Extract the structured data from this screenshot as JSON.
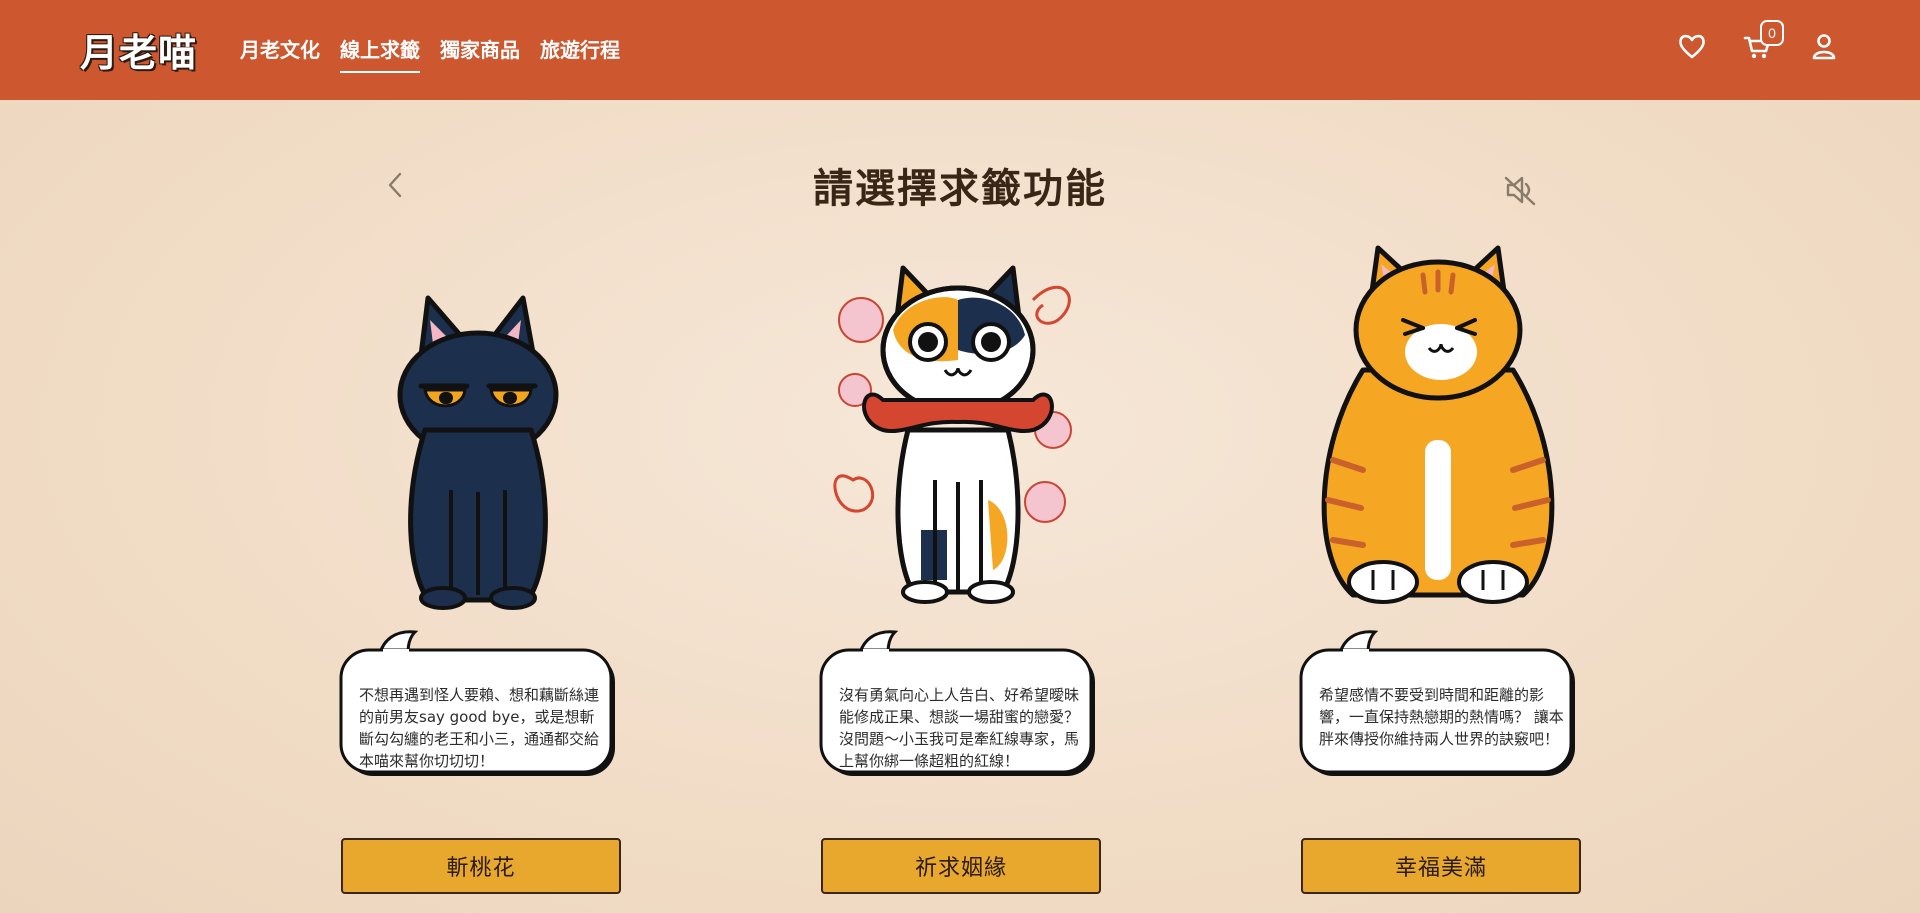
{
  "header": {
    "logo": "月老喵",
    "nav": [
      {
        "label": "月老文化"
      },
      {
        "label": "線上求籤",
        "active": true
      },
      {
        "label": "獨家商品"
      },
      {
        "label": "旅遊行程"
      }
    ],
    "cart_count": "0",
    "icons": [
      "heart-icon",
      "cart-icon",
      "user-icon"
    ]
  },
  "main": {
    "title": "請選擇求籤功能",
    "back_icon": "chevron-left-icon",
    "mute_icon": "volume-mute-icon",
    "cards": [
      {
        "cat": "black-cat",
        "text": "不想再遇到怪人要賴、想和藕斷絲連的前男友say good bye，或是想斬斷勾勾纏的老王和小三，通通都交給本喵來幫你切切切！",
        "button": "斬桃花"
      },
      {
        "cat": "calico-cat",
        "text": "沒有勇氣向心上人告白、好希望曖昧能修成正果、想談一場甜蜜的戀愛？沒問題～小玉我可是牽紅線專家，馬上幫你綁一條超粗的紅線！",
        "button": "祈求姻緣"
      },
      {
        "cat": "orange-tabby-cat",
        "text": "希望感情不要受到時間和距離的影響，一直保持熱戀期的熱情嗎？ 讓本胖來傳授你維持兩人世界的訣竅吧！",
        "button": "幸福美滿"
      }
    ]
  },
  "colors": {
    "header": "#cd572f",
    "background": "#f3e1cf",
    "button": "#e7a82d",
    "title": "#3a2616"
  }
}
